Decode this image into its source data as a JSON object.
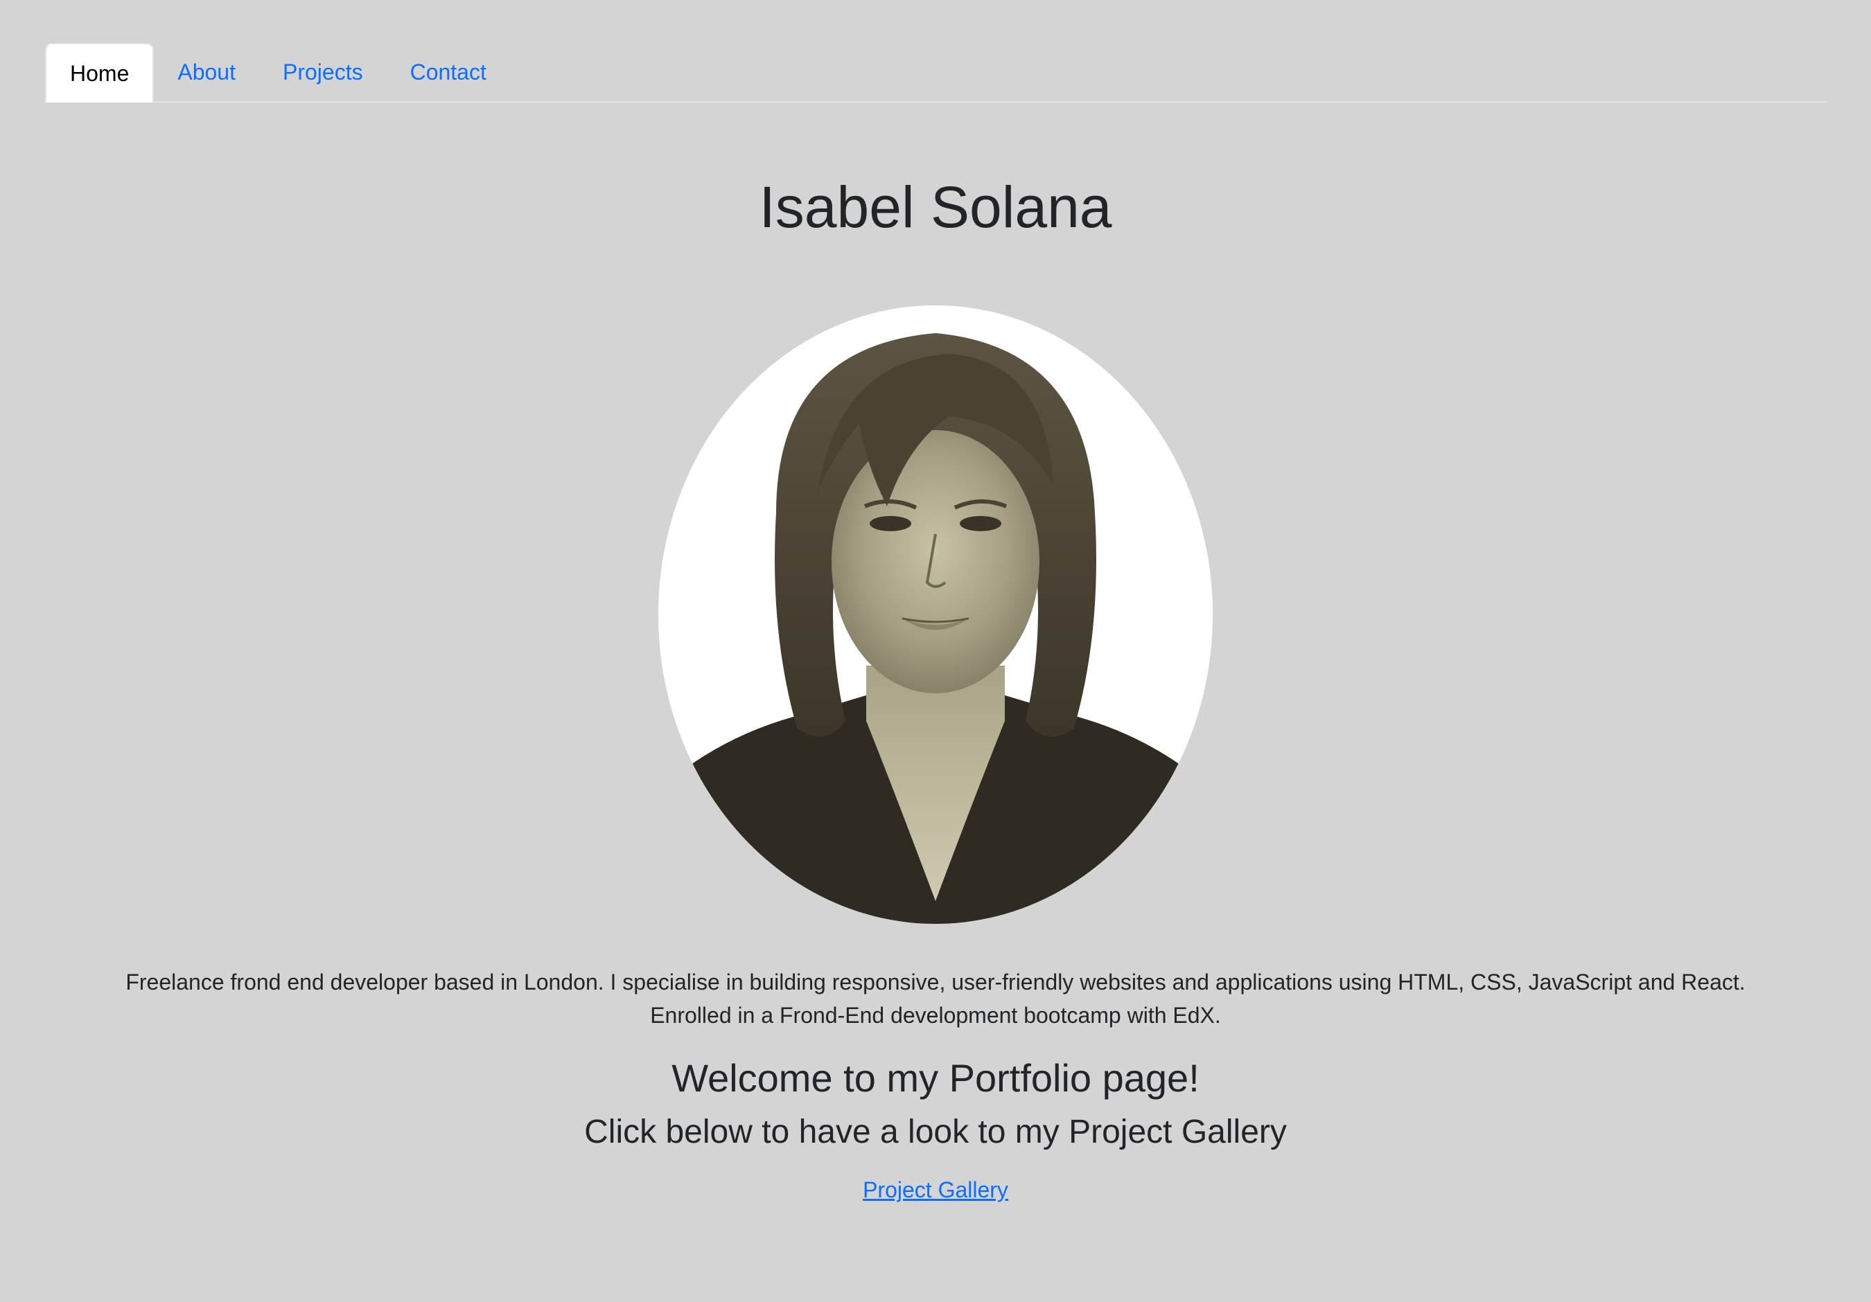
{
  "nav": {
    "tabs": [
      {
        "label": "Home",
        "active": true
      },
      {
        "label": "About",
        "active": false
      },
      {
        "label": "Projects",
        "active": false
      },
      {
        "label": "Contact",
        "active": false
      }
    ]
  },
  "header": {
    "name": "Isabel Solana"
  },
  "bio": {
    "line1": "Freelance frond end developer based in London. I specialise in building responsive, user-friendly websites and applications using HTML, CSS, JavaScript and React.",
    "line2": "Enrolled in a Frond-End development bootcamp with EdX."
  },
  "main": {
    "welcome": "Welcome to my Portfolio page!",
    "subheading": "Click below to have a look to my Project Gallery",
    "gallery_link": "Project Gallery"
  },
  "colors": {
    "background": "#d4d4d4",
    "link": "#0d6efd",
    "text": "#212529"
  }
}
